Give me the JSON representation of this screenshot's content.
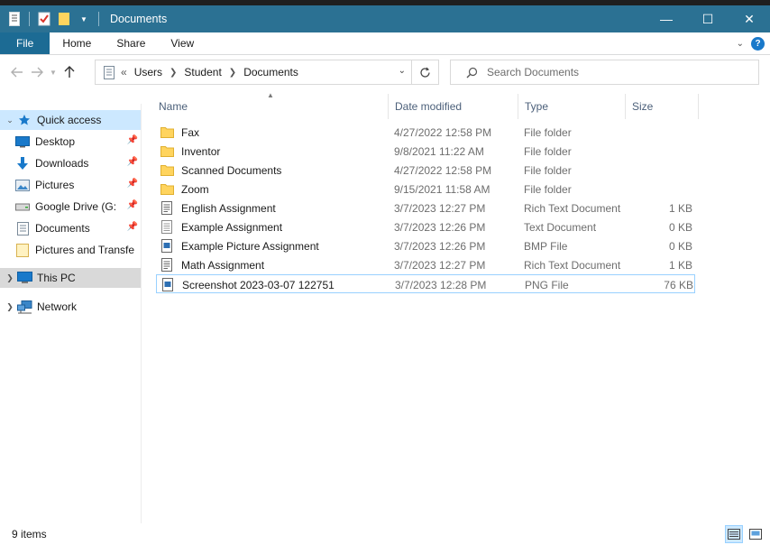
{
  "window": {
    "title": "Documents",
    "minimize_glyph": "—",
    "maximize_glyph": "☐",
    "close_glyph": "✕"
  },
  "ribbon": {
    "tabs": [
      "File",
      "Home",
      "Share",
      "View"
    ],
    "help_glyph": "?"
  },
  "address": {
    "crumbs": [
      "Users",
      "Student",
      "Documents"
    ],
    "overflow_glyph": "«"
  },
  "search": {
    "placeholder": "Search Documents"
  },
  "navpane": {
    "quick_access": "Quick access",
    "quick_items": [
      {
        "label": "Desktop",
        "icon": "desktop-icon",
        "pinned": true
      },
      {
        "label": "Downloads",
        "icon": "downloads-icon",
        "pinned": true
      },
      {
        "label": "Pictures",
        "icon": "pictures-icon",
        "pinned": true
      },
      {
        "label": "Google Drive (G:",
        "icon": "drive-icon",
        "pinned": true
      },
      {
        "label": "Documents",
        "icon": "documents-icon",
        "pinned": true
      },
      {
        "label": "Pictures and Transfe",
        "icon": "folder-icon",
        "pinned": false
      }
    ],
    "this_pc": "This PC",
    "network": "Network"
  },
  "columns": {
    "name": "Name",
    "date": "Date modified",
    "type": "Type",
    "size": "Size"
  },
  "files": [
    {
      "name": "Fax",
      "date": "4/27/2022 12:58 PM",
      "type": "File folder",
      "size": "",
      "icon": "folder-icon"
    },
    {
      "name": "Inventor",
      "date": "9/8/2021 11:22 AM",
      "type": "File folder",
      "size": "",
      "icon": "folder-icon"
    },
    {
      "name": "Scanned Documents",
      "date": "4/27/2022 12:58 PM",
      "type": "File folder",
      "size": "",
      "icon": "folder-icon"
    },
    {
      "name": "Zoom",
      "date": "9/15/2021 11:58 AM",
      "type": "File folder",
      "size": "",
      "icon": "folder-icon"
    },
    {
      "name": "English Assignment",
      "date": "3/7/2023 12:27 PM",
      "type": "Rich Text Document",
      "size": "1 KB",
      "icon": "rtf-document-icon"
    },
    {
      "name": "Example Assignment",
      "date": "3/7/2023 12:26 PM",
      "type": "Text Document",
      "size": "0 KB",
      "icon": "text-document-icon"
    },
    {
      "name": "Example Picture Assignment",
      "date": "3/7/2023 12:26 PM",
      "type": "BMP File",
      "size": "0 KB",
      "icon": "image-file-icon"
    },
    {
      "name": "Math Assignment",
      "date": "3/7/2023 12:27 PM",
      "type": "Rich Text Document",
      "size": "1 KB",
      "icon": "rtf-document-icon"
    },
    {
      "name": "Screenshot 2023-03-07 122751",
      "date": "3/7/2023 12:28 PM",
      "type": "PNG File",
      "size": "76 KB",
      "icon": "image-file-icon"
    }
  ],
  "status": {
    "item_count": "9 items"
  },
  "colors": {
    "titlebar": "#2b7193",
    "file_tab": "#1c6b94",
    "selection": "#cce8ff",
    "folder": "#ffd45e"
  }
}
